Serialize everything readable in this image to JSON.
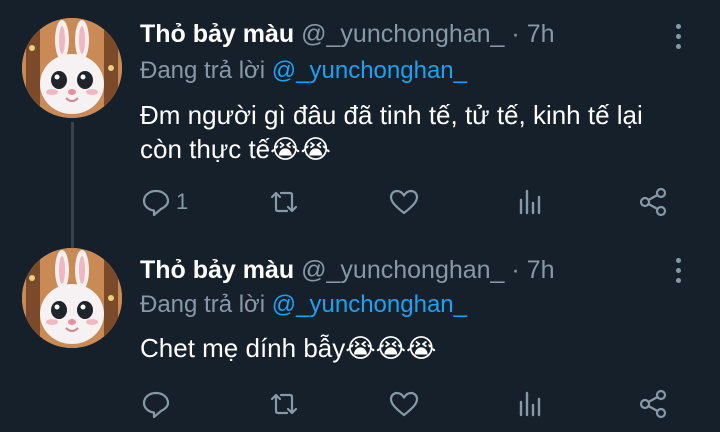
{
  "tweets": [
    {
      "name": "Thỏ bảy màu",
      "handle": "@_yunchonghan_",
      "separator": "·",
      "time": "7h",
      "reply_prefix": "Đang trả lời",
      "reply_to": "@_yunchonghan_",
      "text": "Đm người gì đâu đã tinh tế, tử tế, kinh tế lại còn thực tế",
      "emojis": "😭😭",
      "reply_count": "1"
    },
    {
      "name": "Thỏ bảy màu",
      "handle": "@_yunchonghan_",
      "separator": "·",
      "time": "7h",
      "reply_prefix": "Đang trả lời",
      "reply_to": "@_yunchonghan_",
      "text": "Chet mẹ dính bẫy",
      "emojis": "😭😭😭"
    }
  ],
  "icons": {
    "reply": "reply-icon",
    "retweet": "retweet-icon",
    "like": "like-icon",
    "stats": "stats-icon",
    "share": "share-icon",
    "more": "more-vertical-icon"
  },
  "colors": {
    "background": "#15202b",
    "secondary_text": "#8899a6",
    "mention": "#1da1f2",
    "thread_line": "#38444d"
  }
}
